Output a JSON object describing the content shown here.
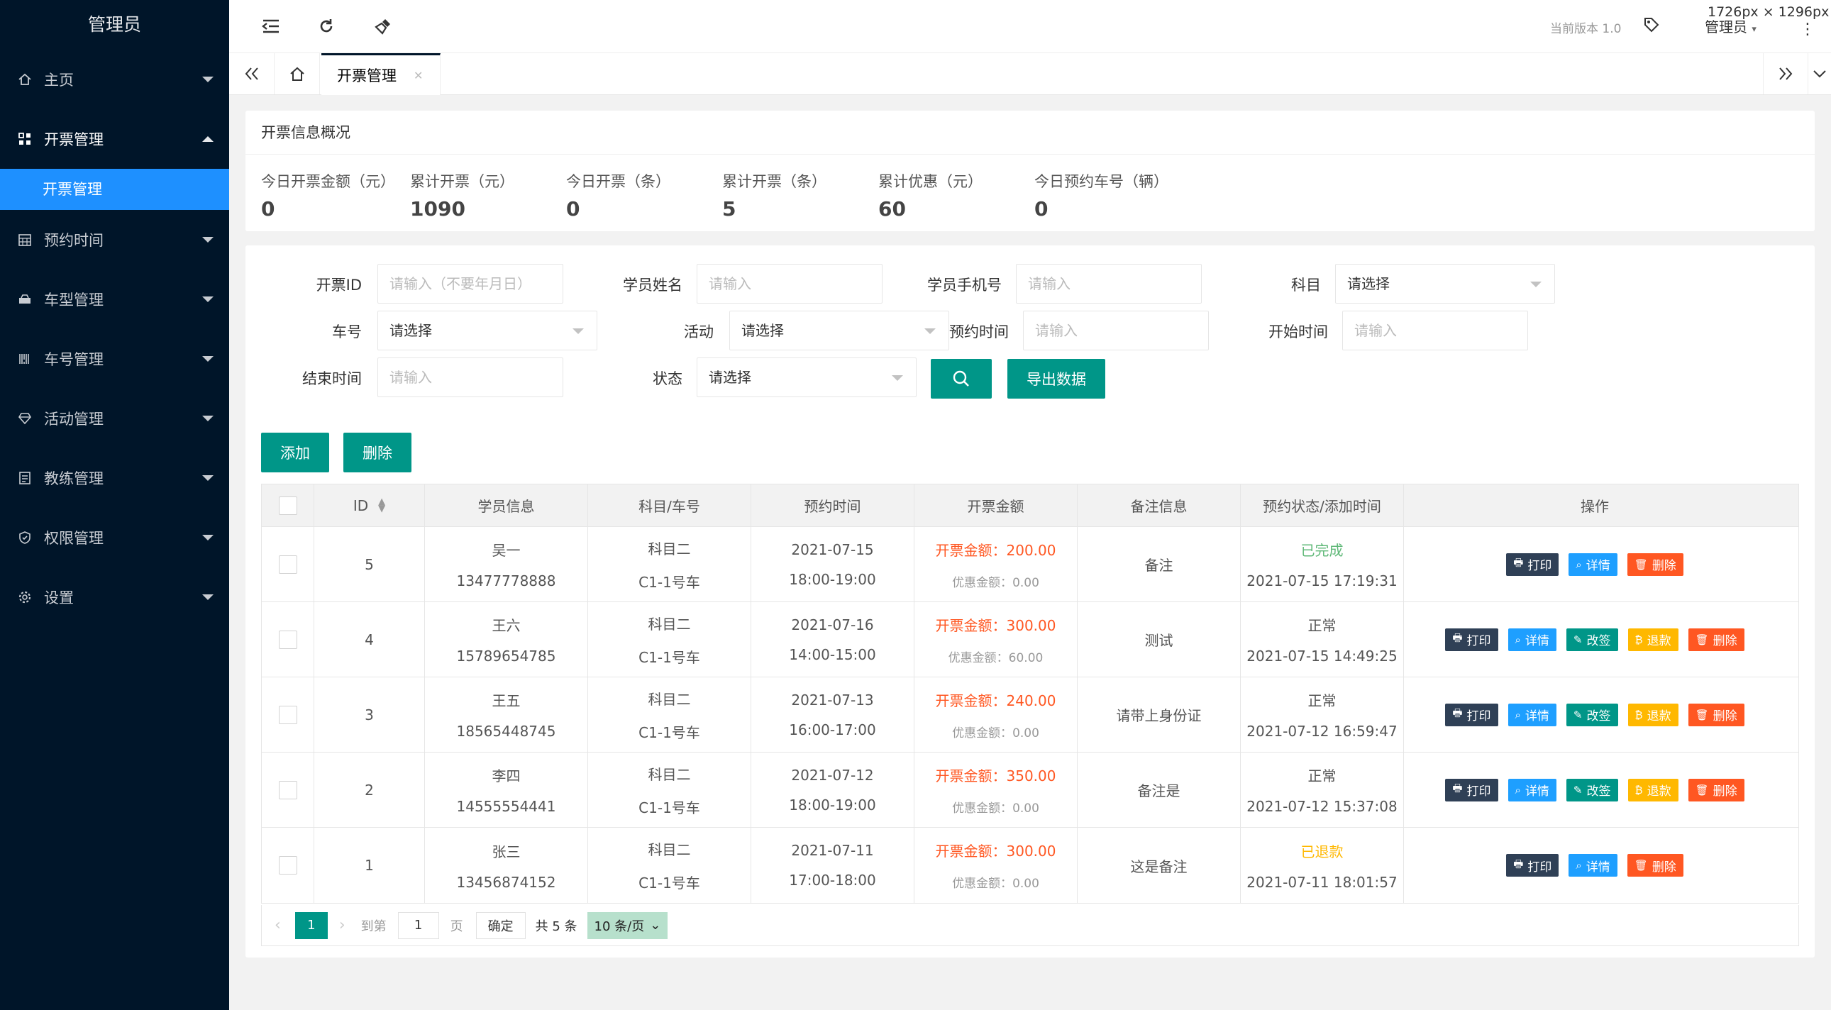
{
  "sidebar": {
    "title": "管理员",
    "items": [
      {
        "label": "主页",
        "icon": "home-icon"
      },
      {
        "label": "开票管理",
        "icon": "grid-icon",
        "open": true
      },
      {
        "label": "预约时间",
        "icon": "calendar-icon"
      },
      {
        "label": "车型管理",
        "icon": "car-icon"
      },
      {
        "label": "车号管理",
        "icon": "barcode-icon"
      },
      {
        "label": "活动管理",
        "icon": "diamond-icon"
      },
      {
        "label": "教练管理",
        "icon": "list-icon"
      },
      {
        "label": "权限管理",
        "icon": "shield-icon"
      },
      {
        "label": "设置",
        "icon": "gear-icon"
      }
    ],
    "sub_item": "开票管理"
  },
  "header": {
    "version": "当前版本 1.0",
    "user": "管理员",
    "size_overlay": "1726px × 1296px"
  },
  "tabs": {
    "active": "开票管理"
  },
  "overview": {
    "title": "开票信息概况",
    "stats": [
      {
        "label": "今日开票金额（元）",
        "value": "0"
      },
      {
        "label": "累计开票（元）",
        "value": "1090"
      },
      {
        "label": "今日开票（条）",
        "value": "0"
      },
      {
        "label": "累计开票（条）",
        "value": "5"
      },
      {
        "label": "累计优惠（元）",
        "value": "60"
      },
      {
        "label": "今日预约车号（辆）",
        "value": "0"
      }
    ]
  },
  "filters": {
    "id_label": "开票ID",
    "id_ph": "请输入（不要年月日）",
    "name_label": "学员姓名",
    "name_ph": "请输入",
    "phone_label": "学员手机号",
    "phone_ph": "请输入",
    "subject_label": "科目",
    "subject_val": "请选择",
    "car_label": "车号",
    "car_val": "请选择",
    "activity_label": "活动",
    "activity_val": "请选择",
    "appt_label": "预约时间",
    "appt_ph": "请输入",
    "start_label": "开始时间",
    "start_ph": "请输入",
    "end_label": "结束时间",
    "end_ph": "请输入",
    "status_label": "状态",
    "status_val": "请选择",
    "export_label": "导出数据"
  },
  "actions": {
    "add": "添加",
    "delete": "删除"
  },
  "table": {
    "headers": [
      "ID",
      "学员信息",
      "科目/车号",
      "预约时间",
      "开票金额",
      "备注信息",
      "预约状态/添加时间",
      "操作"
    ],
    "amount_prefix": "开票金额：",
    "discount_prefix": "优惠金额：",
    "op_labels": {
      "print": "打印",
      "detail": "详情",
      "edit": "改签",
      "refund": "退款",
      "del": "删除"
    },
    "rows": [
      {
        "id": "5",
        "name": "吴一",
        "phone": "13477778888",
        "subject": "科目二",
        "car": "C1-1号车",
        "date": "2021-07-15",
        "time": "18:00-19:00",
        "amount": "200.00",
        "discount": "0.00",
        "note": "备注",
        "status": "已完成",
        "status_type": "ok",
        "added": "2021-07-15 17:19:31",
        "ops": [
          "print",
          "detail",
          "del"
        ]
      },
      {
        "id": "4",
        "name": "王六",
        "phone": "15789654785",
        "subject": "科目二",
        "car": "C1-1号车",
        "date": "2021-07-16",
        "time": "14:00-15:00",
        "amount": "300.00",
        "discount": "60.00",
        "note": "测试",
        "status": "正常",
        "status_type": "normal",
        "added": "2021-07-15 14:49:25",
        "ops": [
          "print",
          "detail",
          "edit",
          "refund",
          "del"
        ]
      },
      {
        "id": "3",
        "name": "王五",
        "phone": "18565448745",
        "subject": "科目二",
        "car": "C1-1号车",
        "date": "2021-07-13",
        "time": "16:00-17:00",
        "amount": "240.00",
        "discount": "0.00",
        "note": "请带上身份证",
        "status": "正常",
        "status_type": "normal",
        "added": "2021-07-12 16:59:47",
        "ops": [
          "print",
          "detail",
          "edit",
          "refund",
          "del"
        ]
      },
      {
        "id": "2",
        "name": "李四",
        "phone": "14555554441",
        "subject": "科目二",
        "car": "C1-1号车",
        "date": "2021-07-12",
        "time": "18:00-19:00",
        "amount": "350.00",
        "discount": "0.00",
        "note": "备注是",
        "status": "正常",
        "status_type": "normal",
        "added": "2021-07-12 15:37:08",
        "ops": [
          "print",
          "detail",
          "edit",
          "refund",
          "del"
        ]
      },
      {
        "id": "1",
        "name": "张三",
        "phone": "13456874152",
        "subject": "科目二",
        "car": "C1-1号车",
        "date": "2021-07-11",
        "time": "17:00-18:00",
        "amount": "300.00",
        "discount": "0.00",
        "note": "这是备注",
        "status": "已退款",
        "status_type": "ref",
        "added": "2021-07-11 18:01:57",
        "ops": [
          "print",
          "detail",
          "del"
        ]
      }
    ]
  },
  "pager": {
    "current": "1",
    "goto_label": "到第",
    "goto_value": "1",
    "page_label": "页",
    "confirm": "确定",
    "total": "共 5 条",
    "size": "10 条/页"
  }
}
